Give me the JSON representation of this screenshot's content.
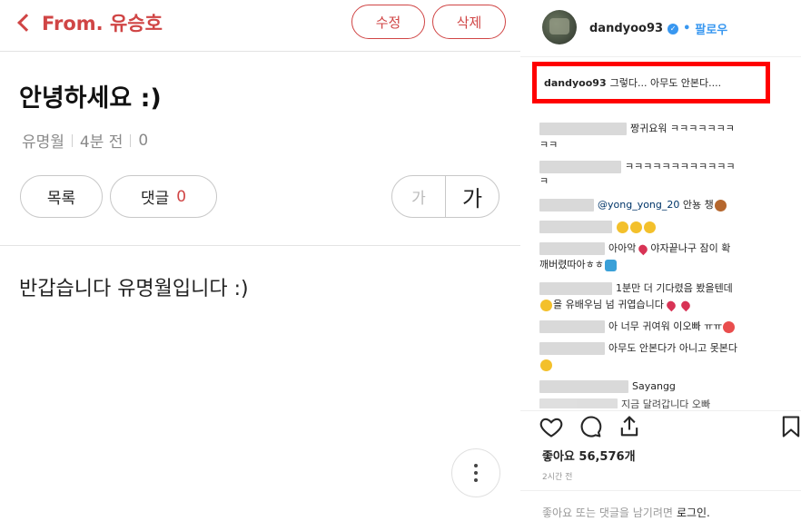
{
  "left": {
    "back_label": "From. 유승호",
    "edit_label": "수정",
    "delete_label": "삭제",
    "post_title": "안녕하세요 :)",
    "author": "유명월",
    "time": "4분 전",
    "views": "0",
    "list_label": "목록",
    "comment_label": "댓글",
    "comment_count": "0",
    "font_small": "가",
    "font_large": "가",
    "body": "반갑습니다 유명월입니다 :)"
  },
  "instagram": {
    "username": "dandyoo93",
    "follow_sep": "•",
    "follow_label": "팔로우",
    "caption_user": "dandyoo93",
    "caption_text": "그렇다... 아무도 안본다....",
    "comments": [
      {
        "text": "짱귀요워 ㅋㅋㅋㅋㅋㅋㅋ"
      },
      {
        "text": "ㅋㅋ"
      },
      {
        "text": "ㅋㅋㅋㅋㅋㅋㅋㅋㅋㅋㅋㅋ"
      },
      {
        "text": "ㅋ"
      },
      {
        "mention": "@yong_yong_20",
        "text": "안뇽 챙"
      },
      {
        "text": ""
      },
      {
        "text": "아아악",
        "text2": "야자끝나구 잠이 확"
      },
      {
        "text": "깨버렸따아ㅎㅎ"
      },
      {
        "text": "1분만 더 기다렸음 봤을텐데"
      },
      {
        "text": "을 유배우님 넘 귀엽습니다"
      },
      {
        "text": "아 너무 귀여워 이오빠 ㅠㅠ"
      },
      {
        "text": "아무도 안본다가 아니고 못본다"
      },
      {
        "text": "Sayangg"
      },
      {
        "text": "지금 달려갑니다 오빠"
      }
    ],
    "likes_label": "좋아요 56,576개",
    "time_ago": "2시간 전",
    "login_prompt": "좋아요 또는 댓글을 남기려면",
    "login_link": "로그인."
  },
  "colors": {
    "accent": "#d04545",
    "highlight_box": "#ff0000",
    "ig_blue": "#3897f0"
  }
}
